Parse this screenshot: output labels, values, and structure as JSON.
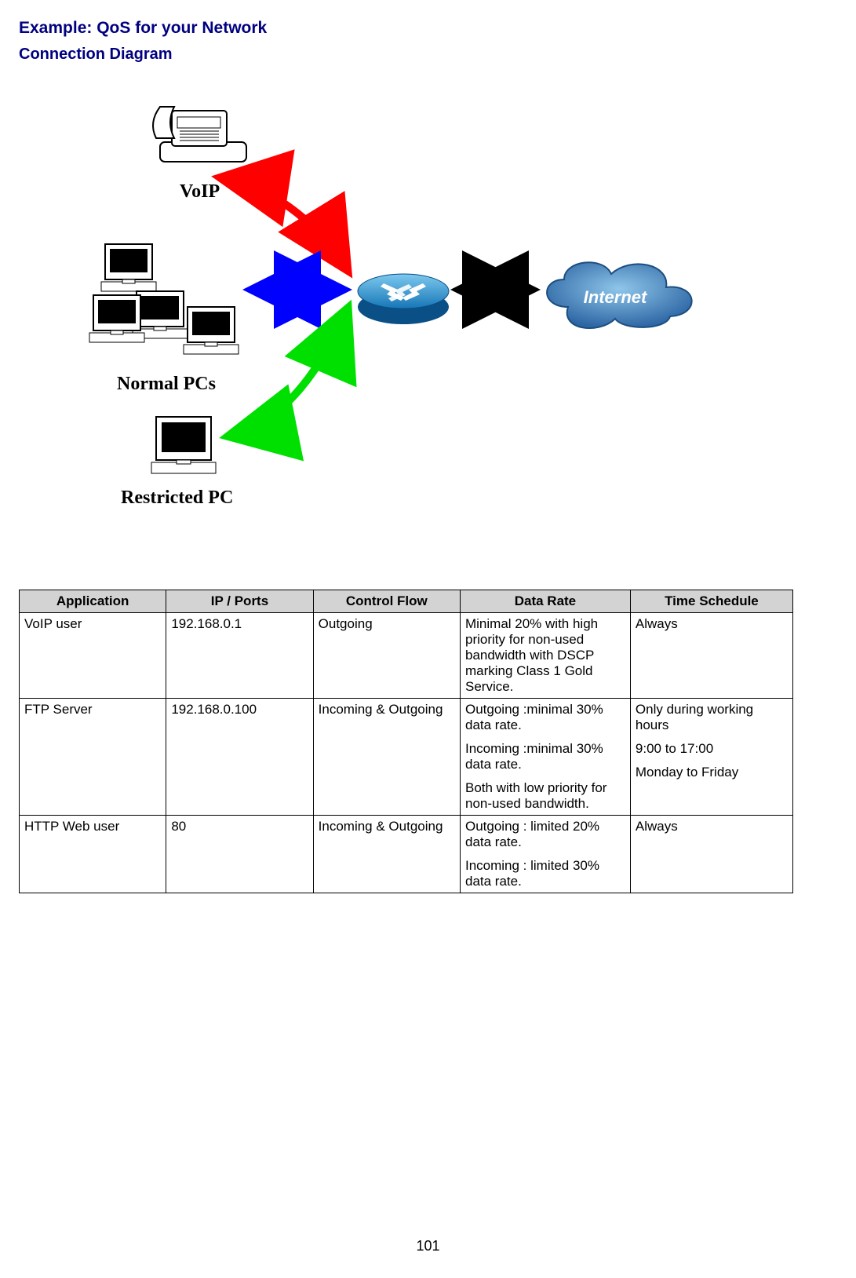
{
  "section_title": "Example: QoS for your Network",
  "subsection_title": "Connection Diagram",
  "diagram": {
    "labels": {
      "voip": "VoIP",
      "normal_pcs": "Normal PCs",
      "restricted_pc": "Restricted PC",
      "internet": "Internet"
    }
  },
  "table": {
    "headers": [
      "Application",
      "IP / Ports",
      "Control Flow",
      "Data Rate",
      "Time Schedule"
    ],
    "rows": [
      {
        "application": "VoIP user",
        "ip_ports": "192.168.0.1",
        "control_flow": "Outgoing",
        "data_rate": [
          "Minimal 20% with high priority for non-used bandwidth with DSCP marking Class 1 Gold Service."
        ],
        "time_schedule": [
          "Always"
        ]
      },
      {
        "application": "FTP Server",
        "ip_ports": "192.168.0.100",
        "control_flow": "Incoming & Outgoing",
        "data_rate": [
          "Outgoing :minimal 30% data rate.",
          "Incoming :minimal 30% data rate.",
          "Both with low priority for non-used bandwidth."
        ],
        "time_schedule": [
          "Only during working hours",
          "9:00 to 17:00",
          "Monday to Friday"
        ]
      },
      {
        "application": "HTTP Web user",
        "ip_ports": "80",
        "control_flow": "Incoming & Outgoing",
        "data_rate": [
          "Outgoing : limited 20% data rate.",
          "Incoming : limited 30% data rate."
        ],
        "time_schedule": [
          "Always"
        ]
      }
    ]
  },
  "page_number": "101"
}
